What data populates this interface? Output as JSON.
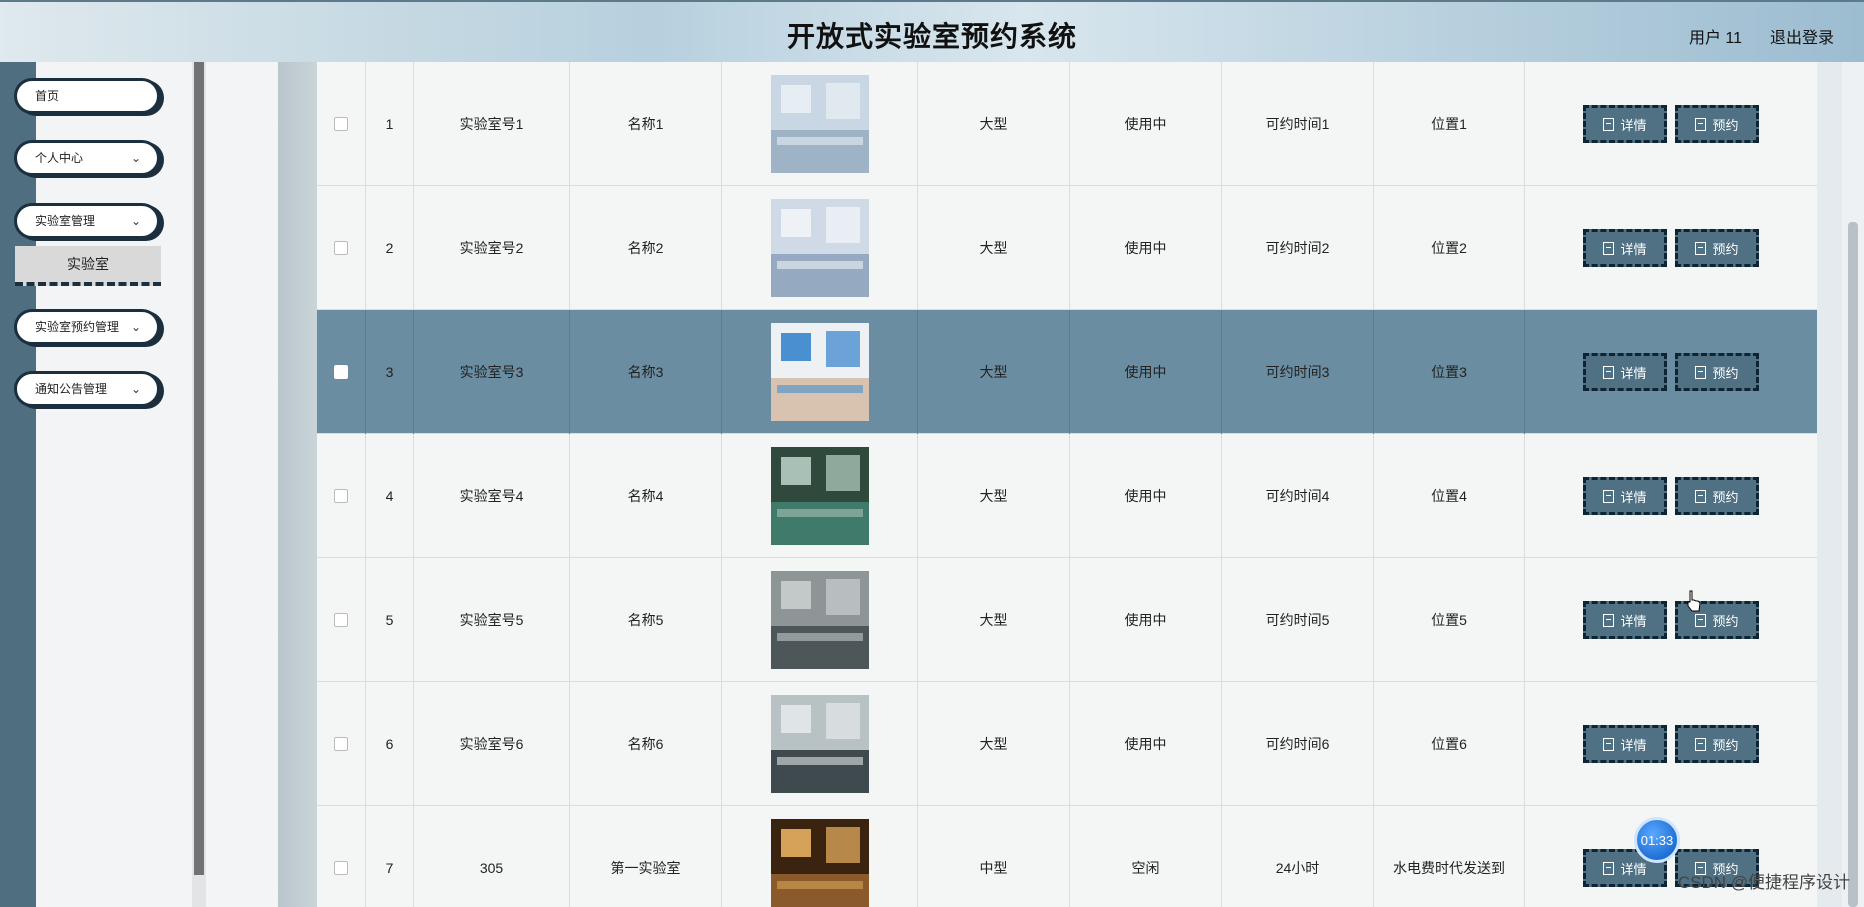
{
  "header": {
    "title": "开放式实验室预约系统",
    "user": "用户 11",
    "logout": "退出登录"
  },
  "sidebar": {
    "items": [
      {
        "label": "首页",
        "has_chevron": false
      },
      {
        "label": "个人中心",
        "has_chevron": true
      },
      {
        "label": "实验室管理",
        "has_chevron": true
      },
      {
        "label": "实验室预约管理",
        "has_chevron": true
      },
      {
        "label": "通知公告管理",
        "has_chevron": true
      }
    ],
    "submenu": {
      "label": "实验室"
    },
    "chevron_icon": "chevron-down-icon"
  },
  "table": {
    "rows": [
      {
        "index": "1",
        "lab_no": "实验室号1",
        "name": "名称1",
        "size": "大型",
        "status": "使用中",
        "time": "可约时间1",
        "location": "位置1",
        "selected": false
      },
      {
        "index": "2",
        "lab_no": "实验室号2",
        "name": "名称2",
        "size": "大型",
        "status": "使用中",
        "time": "可约时间2",
        "location": "位置2",
        "selected": false
      },
      {
        "index": "3",
        "lab_no": "实验室号3",
        "name": "名称3",
        "size": "大型",
        "status": "使用中",
        "time": "可约时间3",
        "location": "位置3",
        "selected": true
      },
      {
        "index": "4",
        "lab_no": "实验室号4",
        "name": "名称4",
        "size": "大型",
        "status": "使用中",
        "time": "可约时间4",
        "location": "位置4",
        "selected": false
      },
      {
        "index": "5",
        "lab_no": "实验室号5",
        "name": "名称5",
        "size": "大型",
        "status": "使用中",
        "time": "可约时间5",
        "location": "位置5",
        "selected": false
      },
      {
        "index": "6",
        "lab_no": "实验室号6",
        "name": "名称6",
        "size": "大型",
        "status": "使用中",
        "time": "可约时间6",
        "location": "位置6",
        "selected": false
      },
      {
        "index": "7",
        "lab_no": "305",
        "name": "第一实验室",
        "size": "中型",
        "status": "空闲",
        "time": "24小时",
        "location": "水电费时代发送到",
        "selected": false
      }
    ],
    "detail_label": "详情",
    "book_label": "预约",
    "button_icon": "document-icon"
  },
  "overlay": {
    "timer": "01:33",
    "watermark": "CSDN @便捷程序设计"
  },
  "colors": {
    "sidebar_strip": "#4f6e80",
    "selected_row": "#6a8da1",
    "button_bg": "#4f7183",
    "button_border": "#0f2433"
  }
}
